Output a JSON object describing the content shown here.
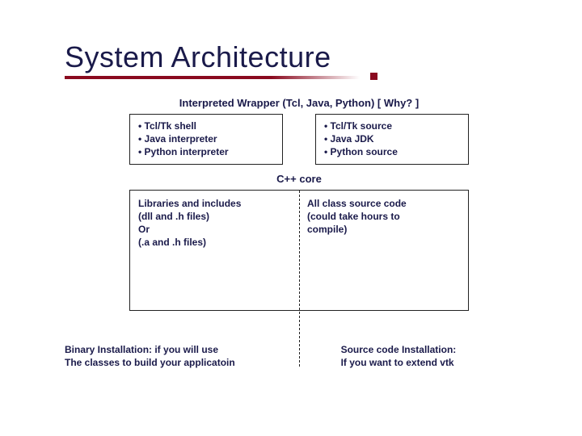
{
  "title": "System Architecture",
  "wrapper": {
    "heading": "Interpreted Wrapper (Tcl, Java, Python) [ Why? ]",
    "left": {
      "b1": "• Tcl/Tk shell",
      "b2": "• Java interpreter",
      "b3": "• Python interpreter"
    },
    "right": {
      "b1": "• Tcl/Tk source",
      "b2": "• Java JDK",
      "b3": "• Python source"
    }
  },
  "core": {
    "heading": "C++ core",
    "left": {
      "l1": "Libraries and includes",
      "l2": "(dll and .h files)",
      "l3": "Or",
      "l4": "(.a and .h files)"
    },
    "right": {
      "l1": "All class source code",
      "l2": "(could take hours to",
      "l3": "compile)"
    }
  },
  "footer": {
    "left": {
      "l1": "Binary Installation: if you will use",
      "l2": "The classes to build your applicatoin"
    },
    "right": {
      "l1": "Source code Installation:",
      "l2": "If you want to extend vtk"
    }
  }
}
